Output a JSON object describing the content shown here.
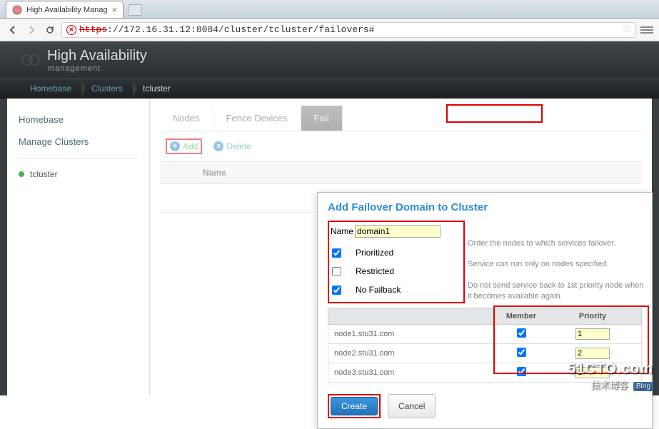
{
  "browser": {
    "tab_title": "High Availability Manag",
    "url_scheme": "https",
    "url_rest": "://172.16.31.12:8084/cluster/tcluster/failovers#"
  },
  "header": {
    "title": "High Availability",
    "subtitle": "management"
  },
  "breadcrumb": [
    "Homebase",
    "Clusters",
    "tcluster"
  ],
  "sidebar": {
    "links": [
      "Homebase",
      "Manage Clusters"
    ],
    "cluster": "tcluster"
  },
  "tabs": [
    "Nodes",
    "Fence Devices",
    "Fail"
  ],
  "actions": {
    "add": "Add",
    "delete": "Delete"
  },
  "grid": {
    "col_name": "Name"
  },
  "dialog": {
    "title": "Add Failover Domain to Cluster",
    "name_label": "Name",
    "name_value": "domain1",
    "options": [
      {
        "label": "Prioritized",
        "checked": true,
        "desc": "Order the nodes to which services failover."
      },
      {
        "label": "Restricted",
        "checked": false,
        "desc": "Service can run only on nodes specified."
      },
      {
        "label": "No Failback",
        "checked": true,
        "desc": "Do not send service back to 1st priority node when it becomes available again."
      }
    ],
    "members_header": {
      "member": "Member",
      "priority": "Priority"
    },
    "members": [
      {
        "node": "node1.stu31.com",
        "member": true,
        "priority": "1"
      },
      {
        "node": "node2.stu31.com",
        "member": true,
        "priority": "2"
      },
      {
        "node": "node3.stu31.com",
        "member": true,
        "priority": "3"
      }
    ],
    "create": "Create",
    "cancel": "Cancel"
  },
  "watermark": {
    "line1": "51CTO.com",
    "line2": "技术博客",
    "badge": "Blog"
  }
}
